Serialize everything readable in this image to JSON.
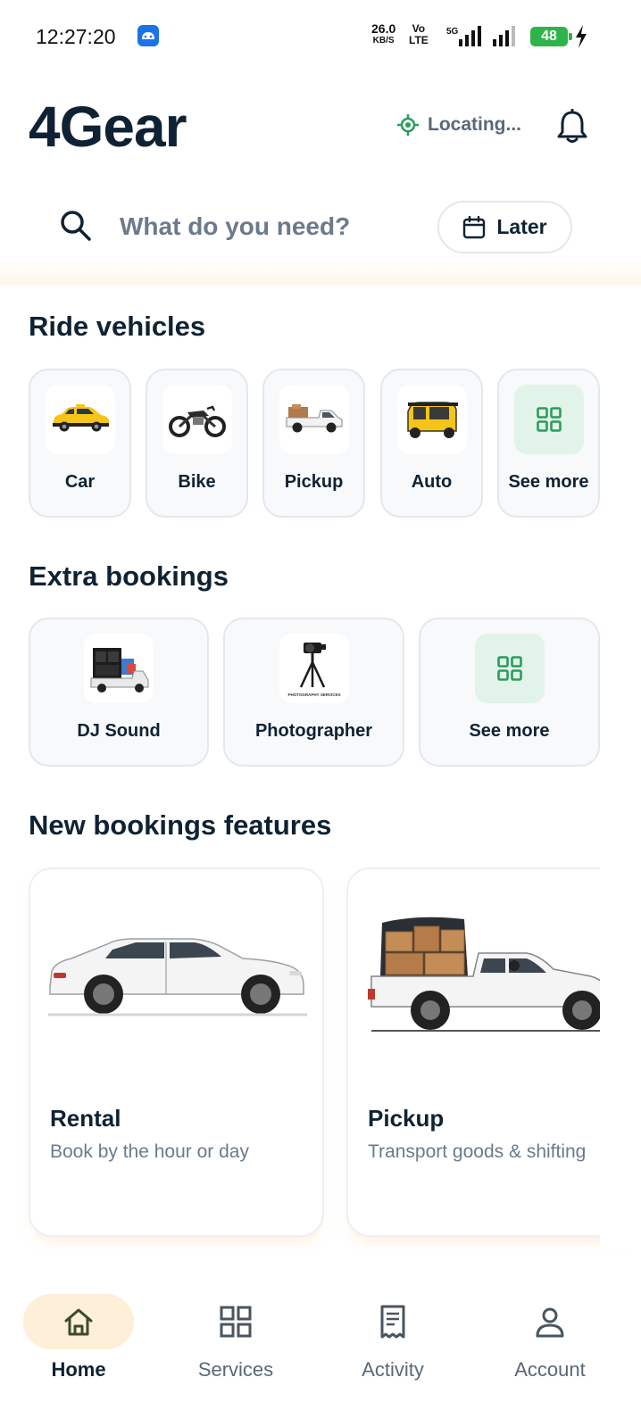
{
  "status_bar": {
    "time": "12:27:20",
    "net_speed": "26.0",
    "net_unit": "KB/S",
    "volte_top": "Vo",
    "volte_bottom": "LTE",
    "network_type": "5G",
    "battery": "48"
  },
  "header": {
    "title": "4Gear",
    "location_status": "Locating...",
    "accent_color": "#2a9d5c"
  },
  "search": {
    "placeholder": "What do you need?",
    "later_label": "Later"
  },
  "ride_vehicles": {
    "title": "Ride vehicles",
    "items": [
      {
        "label": "Car",
        "icon": "taxi-car-icon"
      },
      {
        "label": "Bike",
        "icon": "motorbike-icon"
      },
      {
        "label": "Pickup",
        "icon": "pickup-truck-icon"
      },
      {
        "label": "Auto",
        "icon": "auto-rickshaw-icon"
      },
      {
        "label": "See more",
        "icon": "grid-icon"
      }
    ]
  },
  "extra_bookings": {
    "title": "Extra bookings",
    "items": [
      {
        "label": "DJ Sound",
        "icon": "dj-truck-icon"
      },
      {
        "label": "Photographer",
        "icon": "camera-tripod-icon",
        "image_caption": "PHOTOGRAPHY SERVICES"
      },
      {
        "label": "See more",
        "icon": "grid-icon"
      }
    ]
  },
  "new_features": {
    "title": "New bookings features",
    "cards": [
      {
        "title": "Rental",
        "subtitle": "Book by the hour or day",
        "icon": "sedan-car-icon"
      },
      {
        "title": "Pickup",
        "subtitle": "Transport goods & shifting",
        "icon": "loaded-pickup-icon"
      }
    ]
  },
  "bottom_nav": {
    "items": [
      {
        "label": "Home",
        "icon": "home-icon",
        "active": true
      },
      {
        "label": "Services",
        "icon": "grid-icon",
        "active": false
      },
      {
        "label": "Activity",
        "icon": "receipt-icon",
        "active": false
      },
      {
        "label": "Account",
        "icon": "person-icon",
        "active": false
      }
    ]
  }
}
